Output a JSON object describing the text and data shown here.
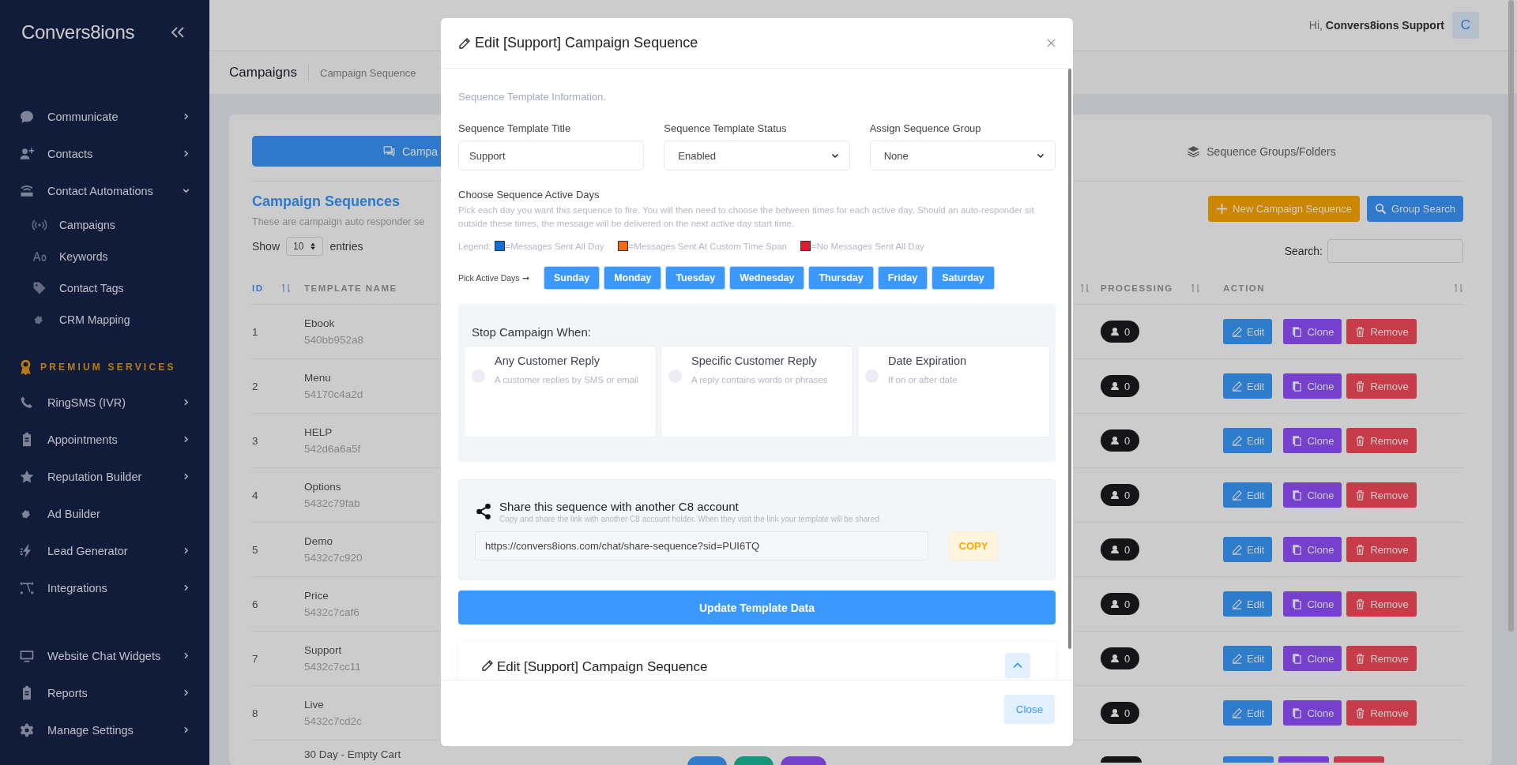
{
  "sidebar": {
    "logo": "Convers8ions",
    "sections": [
      {
        "items": [
          {
            "label": "Communicate",
            "kind": "menu",
            "expanded": false
          },
          {
            "label": "Contacts",
            "kind": "menu",
            "expanded": false
          },
          {
            "label": "Contact Automations",
            "kind": "menu",
            "expanded": true,
            "children": [
              {
                "label": "Campaigns"
              },
              {
                "label": "Keywords"
              },
              {
                "label": "Contact Tags"
              },
              {
                "label": "CRM Mapping"
              }
            ]
          }
        ]
      },
      {
        "heading": "PREMIUM SERVICES",
        "items": [
          {
            "label": "RingSMS (IVR)",
            "kind": "menu",
            "expanded": false
          },
          {
            "label": "Appointments",
            "kind": "menu",
            "expanded": false
          },
          {
            "label": "Reputation Builder",
            "kind": "menu",
            "expanded": false
          },
          {
            "label": "Ad Builder",
            "kind": "link"
          },
          {
            "label": "Lead Generator",
            "kind": "menu",
            "expanded": false
          },
          {
            "label": "Integrations",
            "kind": "menu",
            "expanded": false
          }
        ]
      },
      {
        "items": [
          {
            "label": "Website Chat Widgets",
            "kind": "menu",
            "expanded": false
          },
          {
            "label": "Reports",
            "kind": "menu",
            "expanded": false
          },
          {
            "label": "Manage Settings",
            "kind": "menu",
            "expanded": false
          }
        ]
      }
    ]
  },
  "user": {
    "greeting": "Hi,",
    "name": "Convers8ions Support",
    "avatar": "C"
  },
  "breadcrumb": [
    "Campaigns",
    "Campaign Sequence"
  ],
  "tabs": [
    {
      "label": "Campa",
      "selected": true
    },
    {
      "label": "Sequence Groups/Folders",
      "selected": false
    }
  ],
  "section": {
    "title": "Campaign Sequences",
    "description": "These are campaign auto responder se"
  },
  "length": {
    "before": "Show",
    "value": "10",
    "after": "entries"
  },
  "search": {
    "label": "Search:"
  },
  "actions": [
    "New Campaign Sequence",
    "Group Search"
  ],
  "table": {
    "columns": [
      "ID",
      "TEMPLATE NAME",
      "PROCESSING",
      "ACTION"
    ],
    "rows": [
      {
        "id": "1",
        "name": "Ebook",
        "code": "540bb952a8",
        "processing": "0",
        "actions": [
          "Edit",
          "Clone",
          "Remove"
        ]
      },
      {
        "id": "2",
        "name": "Menu",
        "code": "54170c4a2d",
        "processing": "0",
        "actions": [
          "Edit",
          "Clone",
          "Remove"
        ]
      },
      {
        "id": "3",
        "name": "HELP",
        "code": "542d6a6a5f",
        "processing": "0",
        "actions": [
          "Edit",
          "Clone",
          "Remove"
        ]
      },
      {
        "id": "4",
        "name": "Options",
        "code": "5432c79fab",
        "processing": "0",
        "actions": [
          "Edit",
          "Clone",
          "Remove"
        ]
      },
      {
        "id": "5",
        "name": "Demo",
        "code": "5432c7c920",
        "processing": "0",
        "actions": [
          "Edit",
          "Clone",
          "Remove"
        ]
      },
      {
        "id": "6",
        "name": "Price",
        "code": "5432c7caf6",
        "processing": "0",
        "actions": [
          "Edit",
          "Clone",
          "Remove"
        ]
      },
      {
        "id": "7",
        "name": "Support",
        "code": "5432c7cc11",
        "processing": "0",
        "actions": [
          "Edit",
          "Clone",
          "Remove"
        ]
      },
      {
        "id": "8",
        "name": "Live",
        "code": "5432c7cd2c",
        "processing": "0",
        "actions": [
          "Edit",
          "Clone",
          "Remove"
        ]
      }
    ],
    "partial_row": {
      "name": "30 Day - Empty Cart"
    }
  },
  "modal": {
    "title": "Edit [Support] Campaign Sequence",
    "info": "Sequence Template Information.",
    "fields": [
      {
        "label": "Sequence Template Title",
        "value": "Support",
        "kind": "input"
      },
      {
        "label": "Sequence Template Status",
        "value": "Enabled",
        "kind": "select"
      },
      {
        "label": "Assign Sequence Group",
        "value": "None",
        "kind": "select"
      }
    ],
    "days": {
      "title": "Choose Sequence Active Days",
      "description": "Pick each day you want this sequence to fire. You will then need to choose the between times for each active day. Should an auto-responder sit outside these times, the message will be delivered on the next active day start time.",
      "legend_label": "Legend:",
      "legend": [
        {
          "color": "#0f6fd6",
          "label": "=Messages Sent All Day"
        },
        {
          "color": "#f46a12",
          "label": "=Messages Sent At Custom Time Span"
        },
        {
          "color": "#e0192b",
          "label": "=No Messages Sent All Day"
        }
      ],
      "pick_label": "Pick Active Days ➞",
      "items": [
        {
          "label": "Sunday",
          "selected": true
        },
        {
          "label": "Monday",
          "selected": true
        },
        {
          "label": "Tuesday",
          "selected": true
        },
        {
          "label": "Wednesday",
          "selected": true
        },
        {
          "label": "Thursday",
          "selected": true
        },
        {
          "label": "Friday",
          "selected": true
        },
        {
          "label": "Saturday",
          "selected": true
        }
      ]
    },
    "stop": {
      "title": "Stop Campaign When:",
      "options": [
        {
          "title": "Any Customer Reply",
          "description": "A customer replies by SMS or email",
          "checked": false
        },
        {
          "title": "Specific Customer Reply",
          "description": "A reply contains words or phrases",
          "checked": false
        },
        {
          "title": "Date Expiration",
          "description": "If on or after date",
          "checked": false
        }
      ]
    },
    "share": {
      "title": "Share this sequence with another C8 account",
      "description": "Copy and share the link with another C8 account holder. When they visit the link your template will be shared",
      "url": "https://convers8ions.com/chat/share-sequence?sid=PUI6TQ",
      "copy": "COPY"
    },
    "update": "Update Template Data",
    "collapsed": {
      "title": "Edit [Support] Campaign Sequence",
      "expanded": true
    },
    "close": "Close"
  }
}
